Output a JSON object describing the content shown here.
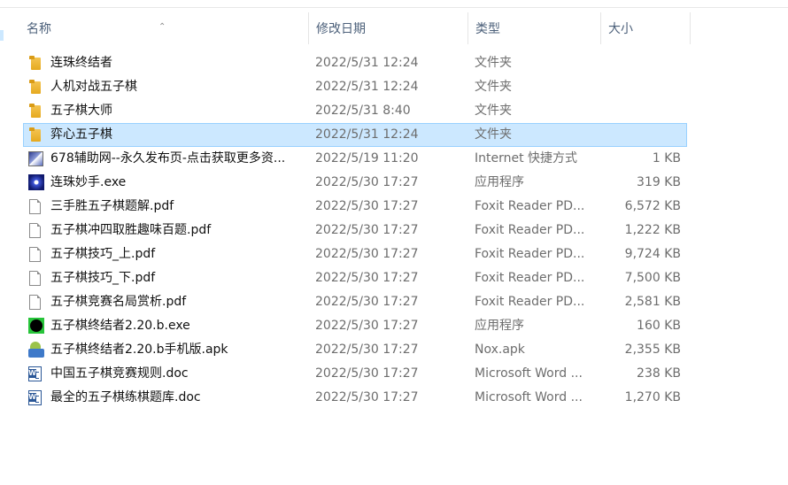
{
  "columns": {
    "name": "名称",
    "date": "修改日期",
    "type": "类型",
    "size": "大小"
  },
  "files": [
    {
      "icon": "folder-icon",
      "name": "连珠终结者",
      "date": "2022/5/31 12:24",
      "type": "文件夹",
      "size": ""
    },
    {
      "icon": "folder-icon",
      "name": "人机对战五子棋",
      "date": "2022/5/31 12:24",
      "type": "文件夹",
      "size": ""
    },
    {
      "icon": "folder-icon",
      "name": "五子棋大师",
      "date": "2022/5/31 8:40",
      "type": "文件夹",
      "size": ""
    },
    {
      "icon": "folder-icon",
      "name": "弈心五子棋",
      "date": "2022/5/31 12:24",
      "type": "文件夹",
      "size": "",
      "selected": true
    },
    {
      "icon": "internet-shortcut-icon",
      "name": "678辅助网--永久发布页-点击获取更多资...",
      "date": "2022/5/19 11:20",
      "type": "Internet 快捷方式",
      "size": "1 KB"
    },
    {
      "icon": "application-icon",
      "name": "连珠妙手.exe",
      "date": "2022/5/30 17:27",
      "type": "应用程序",
      "size": "319 KB"
    },
    {
      "icon": "pdf-document-icon",
      "name": "三手胜五子棋题解.pdf",
      "date": "2022/5/30 17:27",
      "type": "Foxit Reader PD...",
      "size": "6,572 KB"
    },
    {
      "icon": "pdf-document-icon",
      "name": "五子棋冲四取胜趣味百题.pdf",
      "date": "2022/5/30 17:27",
      "type": "Foxit Reader PD...",
      "size": "1,222 KB"
    },
    {
      "icon": "pdf-document-icon",
      "name": "五子棋技巧_上.pdf",
      "date": "2022/5/30 17:27",
      "type": "Foxit Reader PD...",
      "size": "9,724 KB"
    },
    {
      "icon": "pdf-document-icon",
      "name": "五子棋技巧_下.pdf",
      "date": "2022/5/30 17:27",
      "type": "Foxit Reader PD...",
      "size": "7,500 KB"
    },
    {
      "icon": "pdf-document-icon",
      "name": "五子棋竞赛名局赏析.pdf",
      "date": "2022/5/30 17:27",
      "type": "Foxit Reader PD...",
      "size": "2,581 KB"
    },
    {
      "icon": "gomoku-app-icon",
      "name": "五子棋终结者2.20.b.exe",
      "date": "2022/5/30 17:27",
      "type": "应用程序",
      "size": "160 KB"
    },
    {
      "icon": "apk-package-icon",
      "name": "五子棋终结者2.20.b手机版.apk",
      "date": "2022/5/30 17:27",
      "type": "Nox.apk",
      "size": "2,355 KB"
    },
    {
      "icon": "word-document-icon",
      "name": "中国五子棋竞赛规则.doc",
      "date": "2022/5/30 17:27",
      "type": "Microsoft Word ...",
      "size": "238 KB"
    },
    {
      "icon": "word-document-icon",
      "name": "最全的五子棋练棋题库.doc",
      "date": "2022/5/30 17:27",
      "type": "Microsoft Word ...",
      "size": "1,270 KB"
    }
  ],
  "colors": {
    "selection_bg": "#cce8ff",
    "selection_border": "#99d1ff",
    "header_text": "#4c607a"
  }
}
